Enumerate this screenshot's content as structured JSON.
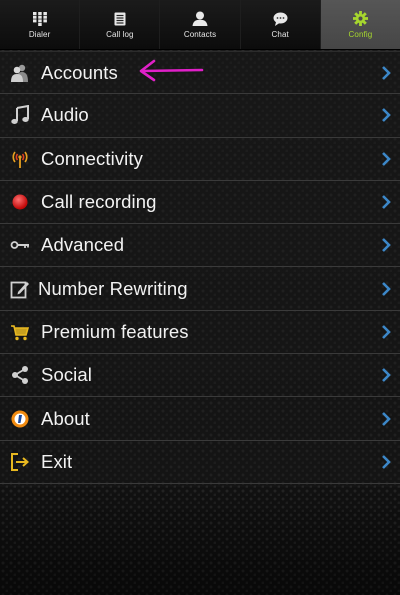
{
  "tabs": [
    {
      "label": "Dialer",
      "icon": "dialpad-icon",
      "active": false
    },
    {
      "label": "Call log",
      "icon": "call-log-icon",
      "active": false
    },
    {
      "label": "Contacts",
      "icon": "contacts-icon",
      "active": false
    },
    {
      "label": "Chat",
      "icon": "chat-bubble-icon",
      "active": false
    },
    {
      "label": "Config",
      "icon": "gear-icon",
      "active": true
    }
  ],
  "menu": {
    "items": [
      {
        "label": "Accounts",
        "icon": "accounts-icon"
      },
      {
        "label": "Audio",
        "icon": "music-note-icon"
      },
      {
        "label": "Connectivity",
        "icon": "antenna-icon"
      },
      {
        "label": "Call recording",
        "icon": "record-dot-icon"
      },
      {
        "label": "Advanced",
        "icon": "key-icon"
      },
      {
        "label": "Number Rewriting",
        "icon": "edit-icon"
      },
      {
        "label": "Premium features",
        "icon": "cart-icon"
      },
      {
        "label": "Social",
        "icon": "share-icon"
      },
      {
        "label": "About",
        "icon": "about-icon"
      },
      {
        "label": "Exit",
        "icon": "exit-icon"
      }
    ]
  },
  "colors": {
    "active_tab_text": "#a6d62e",
    "chevron": "#3c87c8",
    "annotation_arrow": "#e020c8",
    "record_dot": "#e01818"
  }
}
